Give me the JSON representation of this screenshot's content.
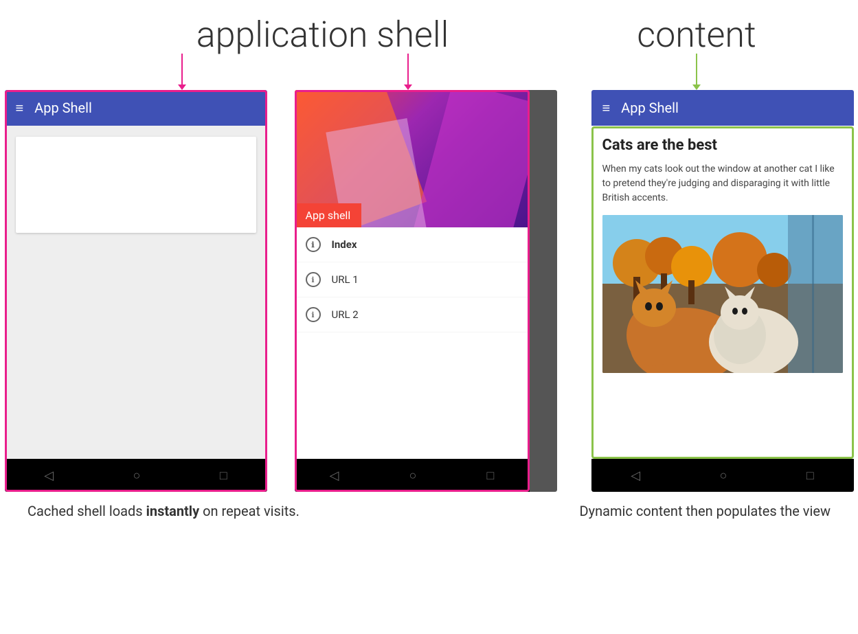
{
  "header": {
    "app_shell_label": "application shell",
    "content_label": "content"
  },
  "phone1": {
    "app_bar_title": "App Shell",
    "nav": [
      "◁",
      "○",
      "□"
    ]
  },
  "phone2": {
    "hero_label": "App shell",
    "menu_items": [
      {
        "label": "Index",
        "active": true
      },
      {
        "label": "URL 1",
        "active": false
      },
      {
        "label": "URL 2",
        "active": false
      }
    ],
    "nav": [
      "◁",
      "○",
      "□"
    ]
  },
  "phone3": {
    "app_bar_title": "App Shell",
    "content_title": "Cats are the best",
    "content_text": "When my cats look out the window at another cat I like to pretend they're judging and disparaging it with little British accents.",
    "nav": [
      "◁",
      "○",
      "□"
    ]
  },
  "bottom": {
    "left_text_start": "Cached shell loads ",
    "left_text_bold": "instantly",
    "left_text_end": " on repeat visits.",
    "right_text": "Dynamic content then populates the view"
  }
}
